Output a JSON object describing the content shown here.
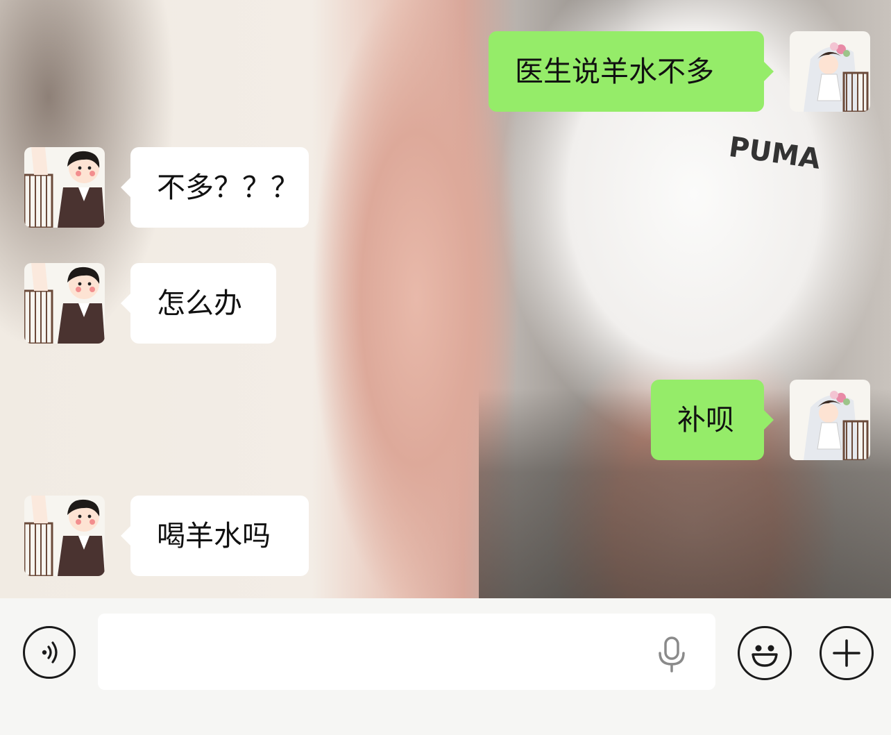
{
  "messages": [
    {
      "side": "out",
      "text": "医生说羊水不多"
    },
    {
      "side": "in",
      "text": "不多？？？"
    },
    {
      "side": "in",
      "text": "怎么办"
    },
    {
      "side": "out",
      "text": "补呗"
    },
    {
      "side": "in",
      "text": "喝羊水吗"
    }
  ],
  "colors": {
    "outgoing_bubble": "#95ec69",
    "incoming_bubble": "#ffffff"
  },
  "toolbar": {
    "voice_icon": "voice-wave-icon",
    "input_value": "",
    "mic_icon": "microphone-icon",
    "emoji_icon": "smiley-icon",
    "more_icon": "plus-icon"
  }
}
